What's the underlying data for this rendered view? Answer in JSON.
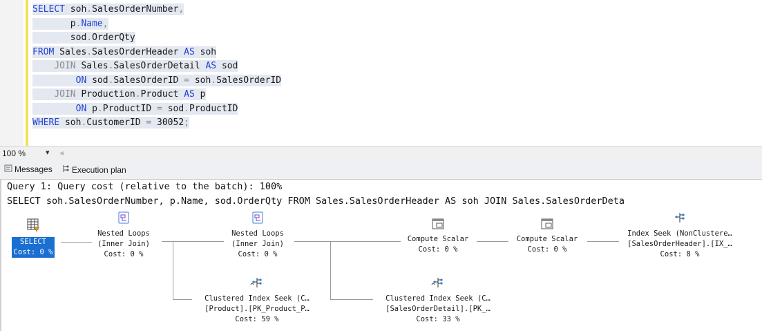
{
  "editor": {
    "lines": [
      [
        {
          "t": "SELECT ",
          "c": "kw"
        },
        {
          "t": "soh",
          "c": "tx"
        },
        {
          "t": ".",
          "c": "gr"
        },
        {
          "t": "SalesOrderNumber",
          "c": "tx"
        },
        {
          "t": ",",
          "c": "gr"
        }
      ],
      [
        {
          "t": "       ",
          "c": "tx"
        },
        {
          "t": "p",
          "c": "tx"
        },
        {
          "t": ".",
          "c": "gr"
        },
        {
          "t": "Name",
          "c": "kw"
        },
        {
          "t": ",",
          "c": "gr"
        }
      ],
      [
        {
          "t": "       ",
          "c": "tx"
        },
        {
          "t": "sod",
          "c": "tx"
        },
        {
          "t": ".",
          "c": "gr"
        },
        {
          "t": "OrderQty",
          "c": "tx"
        }
      ],
      [
        {
          "t": "FROM ",
          "c": "kw"
        },
        {
          "t": "Sales",
          "c": "tx"
        },
        {
          "t": ".",
          "c": "gr"
        },
        {
          "t": "SalesOrderHeader ",
          "c": "tx"
        },
        {
          "t": "AS ",
          "c": "kw"
        },
        {
          "t": "soh",
          "c": "tx"
        }
      ],
      [
        {
          "t": "    ",
          "c": "tx"
        },
        {
          "t": "JOIN ",
          "c": "gr"
        },
        {
          "t": "Sales",
          "c": "tx"
        },
        {
          "t": ".",
          "c": "gr"
        },
        {
          "t": "SalesOrderDetail ",
          "c": "tx"
        },
        {
          "t": "AS ",
          "c": "kw"
        },
        {
          "t": "sod",
          "c": "tx"
        }
      ],
      [
        {
          "t": "        ",
          "c": "tx"
        },
        {
          "t": "ON ",
          "c": "kw"
        },
        {
          "t": "sod",
          "c": "tx"
        },
        {
          "t": ".",
          "c": "gr"
        },
        {
          "t": "SalesOrderID ",
          "c": "tx"
        },
        {
          "t": "= ",
          "c": "gr"
        },
        {
          "t": "soh",
          "c": "tx"
        },
        {
          "t": ".",
          "c": "gr"
        },
        {
          "t": "SalesOrderID",
          "c": "tx"
        }
      ],
      [
        {
          "t": "    ",
          "c": "tx"
        },
        {
          "t": "JOIN ",
          "c": "gr"
        },
        {
          "t": "Production",
          "c": "tx"
        },
        {
          "t": ".",
          "c": "gr"
        },
        {
          "t": "Product ",
          "c": "tx"
        },
        {
          "t": "AS ",
          "c": "kw"
        },
        {
          "t": "p",
          "c": "tx"
        }
      ],
      [
        {
          "t": "        ",
          "c": "tx"
        },
        {
          "t": "ON ",
          "c": "kw"
        },
        {
          "t": "p",
          "c": "tx"
        },
        {
          "t": ".",
          "c": "gr"
        },
        {
          "t": "ProductID ",
          "c": "tx"
        },
        {
          "t": "= ",
          "c": "gr"
        },
        {
          "t": "sod",
          "c": "tx"
        },
        {
          "t": ".",
          "c": "gr"
        },
        {
          "t": "ProductID",
          "c": "tx"
        }
      ],
      [
        {
          "t": "WHERE ",
          "c": "kw"
        },
        {
          "t": "soh",
          "c": "tx"
        },
        {
          "t": ".",
          "c": "gr"
        },
        {
          "t": "CustomerID ",
          "c": "tx"
        },
        {
          "t": "= ",
          "c": "gr"
        },
        {
          "t": "30052",
          "c": "tx"
        },
        {
          "t": ";",
          "c": "gr"
        }
      ]
    ]
  },
  "zoom": {
    "value": "100 %",
    "dropdown": "▾",
    "scroll": "◂"
  },
  "tabs": {
    "messages": "Messages",
    "plan": "Execution plan"
  },
  "plan": {
    "query_title": "Query 1: Query cost (relative to the batch): 100%",
    "query_sql": "SELECT soh.SalesOrderNumber, p.Name, sod.OrderQty FROM Sales.SalesOrderHeader AS soh JOIN Sales.SalesOrderDeta",
    "ops": {
      "select": {
        "l1": "SELECT",
        "l2": "Cost: 0 %"
      },
      "nl1": {
        "l1": "Nested Loops",
        "l2": "(Inner Join)",
        "l3": "Cost: 0 %"
      },
      "nl2": {
        "l1": "Nested Loops",
        "l2": "(Inner Join)",
        "l3": "Cost: 0 %"
      },
      "cs1": {
        "l1": "Compute Scalar",
        "l2": "Cost: 0 %"
      },
      "cs2": {
        "l1": "Compute Scalar",
        "l2": "Cost: 0 %"
      },
      "idx": {
        "l1": "Index Seek (NonClustere…",
        "l2": "[SalesOrderHeader].[IX_…",
        "l3": "Cost: 8 %"
      },
      "cis1": {
        "l1": "Clustered Index Seek (C…",
        "l2": "[Product].[PK_Product_P…",
        "l3": "Cost: 59 %"
      },
      "cis2": {
        "l1": "Clustered Index Seek (C…",
        "l2": "[SalesOrderDetail].[PK_…",
        "l3": "Cost: 33 %"
      }
    }
  }
}
